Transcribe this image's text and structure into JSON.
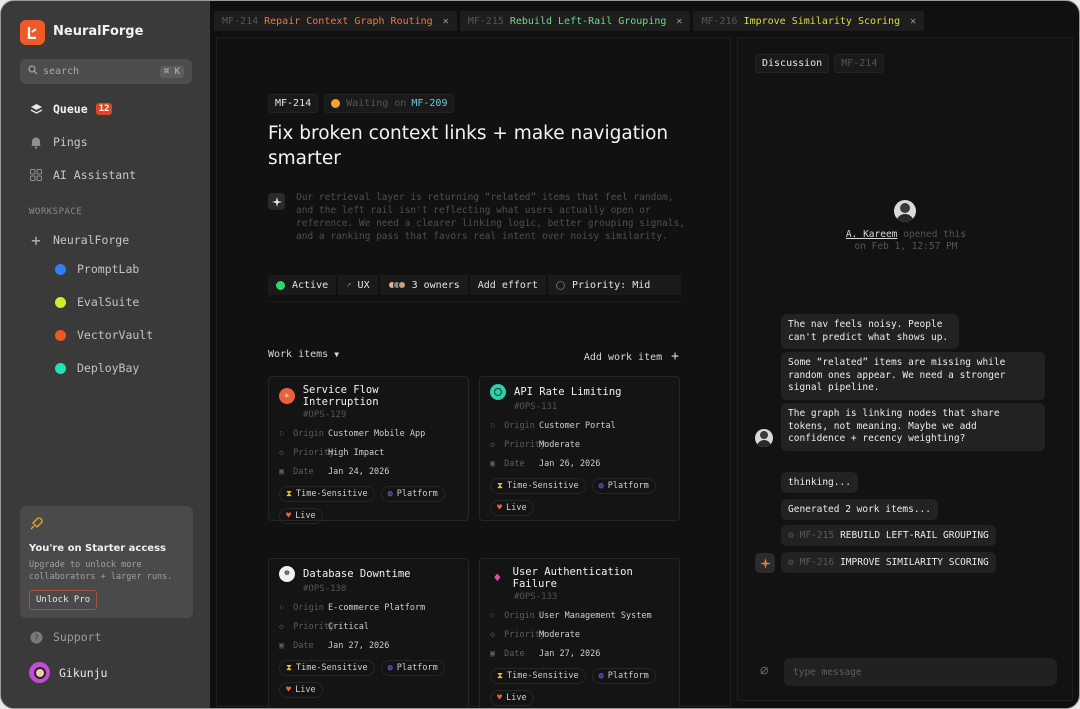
{
  "app": {
    "name": "NeuralForge"
  },
  "search": {
    "placeholder": "search",
    "shortcut": "⌘ K"
  },
  "nav": [
    {
      "label": "Queue",
      "icon": "stack-icon",
      "badge": "12"
    },
    {
      "label": "Pings",
      "icon": "bell-icon"
    },
    {
      "label": "AI Assistant",
      "icon": "grid-icon"
    }
  ],
  "workspace": {
    "label": "WORKSPACE",
    "root": "NeuralForge",
    "projects": [
      {
        "label": "PromptLab",
        "color": "#2d7df6"
      },
      {
        "label": "EvalSuite",
        "color": "#d6e82c"
      },
      {
        "label": "VectorVault",
        "color": "#f0561f"
      },
      {
        "label": "DeployBay",
        "color": "#22e2b4"
      }
    ]
  },
  "upgrade": {
    "title": "You're on Starter access",
    "desc": "Upgrade to unlock more collaborators + larger runs.",
    "button": "Unlock Pro"
  },
  "support": "Support",
  "user": {
    "name": "Gikunju"
  },
  "tabs": [
    {
      "id": "MF-214",
      "title": "Repair Context Graph Routing",
      "color": "#e9774b"
    },
    {
      "id": "MF-215",
      "title": "Rebuild Left-Rail Grouping",
      "color": "#6fd98a"
    },
    {
      "id": "MF-216",
      "title": "Improve Similarity Scoring",
      "color": "#e2d84a"
    }
  ],
  "issue": {
    "id": "MF-214",
    "waiting_prefix": "Waiting on",
    "waiting_id": "MF-209",
    "title": "Fix broken context links + make navigation smarter",
    "description": "Our retrieval layer is returning “related” items that feel random, and the left rail isn't reflecting what users actually open or reference. We need a clearer linking logic, better grouping signals, and a ranking pass that favors real intent over noisy similarity.",
    "status": "Active",
    "label": "UX",
    "owners": "3 owners",
    "effort": "Add effort",
    "priority": "Priority: Mid"
  },
  "work_items": {
    "header": "Work items",
    "add": "Add work item",
    "keys": {
      "origin": "Origin",
      "priority": "Priority",
      "date": "Date"
    },
    "items": [
      {
        "title": "Service Flow Interruption",
        "code": "#OPS-129",
        "origin": "Customer Mobile App",
        "priority": "High Impact",
        "date": "Jan 24, 2026",
        "tags": [
          "Time-Sensitive",
          "Platform",
          "Live"
        ],
        "icon": "asterisk-icon",
        "icon_color": "#e8603c"
      },
      {
        "title": "API Rate Limiting",
        "code": "#OPS-131",
        "origin": "Customer Portal",
        "priority": "Moderate",
        "date": "Jan 26, 2026",
        "tags": [
          "Time-Sensitive",
          "Platform",
          "Live"
        ],
        "icon": "openai-icon",
        "icon_color": "#2fd0a8"
      },
      {
        "title": "Database Downtime",
        "code": "#OPS-130",
        "origin": "E-commerce Platform",
        "priority": "Critical",
        "date": "Jan 27, 2026",
        "tags": [
          "Time-Sensitive",
          "Platform",
          "Live"
        ],
        "icon": "bug-icon",
        "icon_color": "#ffffff"
      },
      {
        "title": "User Authentication Failure",
        "code": "#OPS-133",
        "origin": "User Management System",
        "priority": "Moderate",
        "date": "Jan 27, 2026",
        "tags": [
          "Time-Sensitive",
          "Platform",
          "Live"
        ],
        "icon": "flame-icon",
        "icon_color": "#e14ea0"
      }
    ]
  },
  "discussion": {
    "tab": "Discussion",
    "id": "MF-214",
    "opener": "A. Kareem",
    "opened_text": "opened this",
    "opened_at": "on Feb 1, 12:57 PM",
    "messages": [
      "The nav feels noisy. People can't predict what shows up.",
      "Some “related” items are missing while random ones appear. We need a stronger signal pipeline.",
      "The graph is linking nodes that share tokens, not meaning. Maybe we add confidence + recency weighting?"
    ],
    "thinking": "thinking...",
    "generated": "Generated 2 work items...",
    "generated_items": [
      {
        "id": "MF-215",
        "title": "REBUILD LEFT-RAIL GROUPING"
      },
      {
        "id": "MF-216",
        "title": "IMPROVE SIMILARITY SCORING"
      }
    ],
    "input_placeholder": "type message"
  }
}
